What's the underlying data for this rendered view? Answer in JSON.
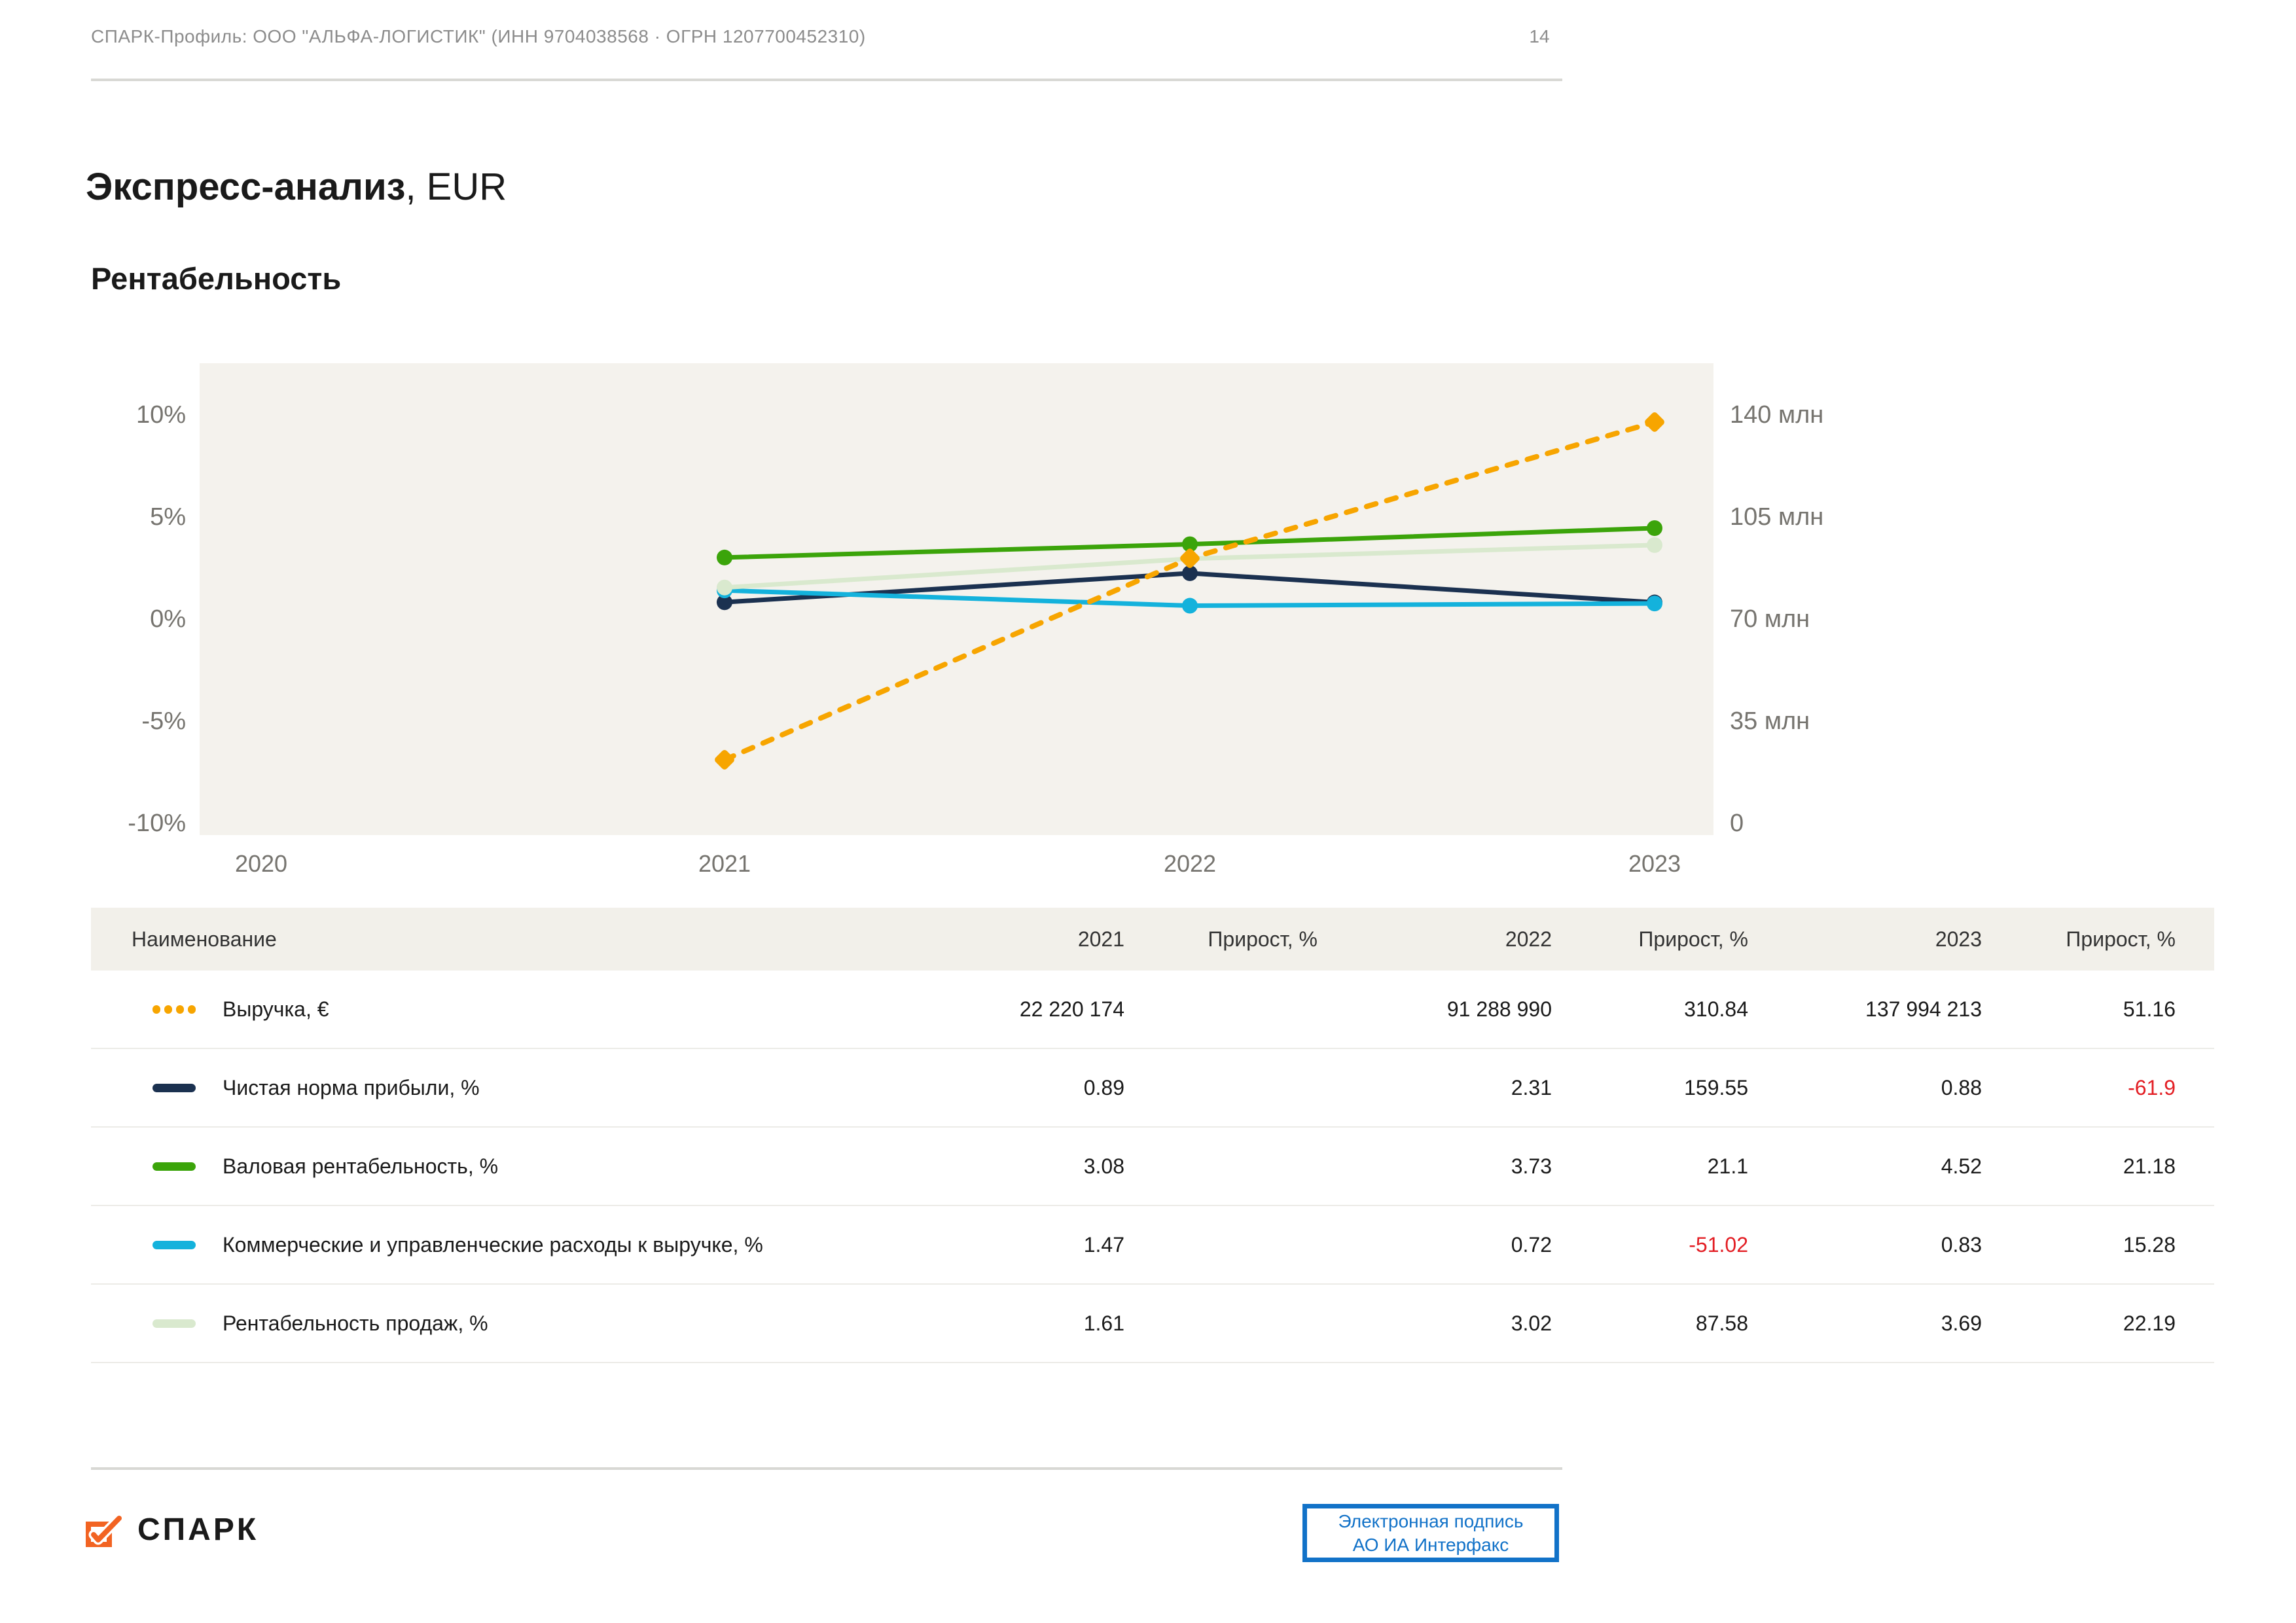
{
  "page": {
    "header": {
      "profile_line": "СПАРК-Профиль: ООО \"АЛЬФА-ЛОГИСТИК\" (ИНН 9704038568 · ОГРН 1207700452310)",
      "page_number": "14"
    },
    "title": {
      "main": "Экспресс-анализ",
      "suffix": ", EUR"
    },
    "section_title": "Рентабельность",
    "footer": {
      "logo_text": "СПАРК",
      "signature_button": {
        "line1": "Электронная подпись",
        "line2": "АО ИА Интерфакс"
      }
    }
  },
  "palette": {
    "plot_bg": "#F4F2ED",
    "table_header_bg": "#F2F0EA",
    "text": "#1A1A1A",
    "axis_text": "#76746F",
    "header_gray": "#8C8C8C",
    "divider": "#D8D8D4",
    "row_divider": "#ECEBE7",
    "negative": "#E31E24",
    "button_blue": "#1272C8",
    "logo_orange": "#F26322"
  },
  "chart_data": {
    "type": "line",
    "title": "Рентабельность",
    "categories": [
      "2020",
      "2021",
      "2022",
      "2023"
    ],
    "grid": false,
    "legend_position": "table-below",
    "left_axis": {
      "unit": "%",
      "min": -10,
      "max": 10,
      "ticks": [
        "10%",
        "5%",
        "0%",
        "-5%",
        "-10%"
      ]
    },
    "right_axis": {
      "unit": "млн",
      "min": 0,
      "max": 140,
      "ticks": [
        "140 млн",
        "105 млн",
        "70 млн",
        "35 млн",
        "0"
      ]
    },
    "series": [
      {
        "name": "Выручка, €",
        "axis": "right",
        "style": "dashed",
        "marker": "diamond",
        "color": "#F7A500",
        "values": [
          null,
          22220174,
          91288990,
          137994213
        ]
      },
      {
        "name": "Чистая норма прибыли, %",
        "axis": "left",
        "style": "solid",
        "marker": "circle",
        "color": "#1B3150",
        "values": [
          null,
          0.89,
          2.31,
          0.88
        ]
      },
      {
        "name": "Валовая рентабельность, %",
        "axis": "left",
        "style": "solid",
        "marker": "circle",
        "color": "#3BA40A",
        "values": [
          null,
          3.08,
          3.73,
          4.52
        ]
      },
      {
        "name": "Коммерческие и управленческие расходы к выручке, %",
        "axis": "left",
        "style": "solid",
        "marker": "circle",
        "color": "#14B2DC",
        "values": [
          null,
          1.47,
          0.72,
          0.83
        ]
      },
      {
        "name": "Рентабельность продаж, %",
        "axis": "left",
        "style": "solid",
        "marker": "circle",
        "color": "#D9E9CE",
        "values": [
          null,
          1.61,
          3.02,
          3.69
        ]
      }
    ]
  },
  "table": {
    "columns": [
      "Наименование",
      "2021",
      "Прирост, %",
      "2022",
      "Прирост, %",
      "2023",
      "Прирост, %"
    ],
    "rows": [
      {
        "name": "Выручка, €",
        "series_index": 0,
        "values": [
          "22 220 174",
          "",
          "91 288 990",
          "310.84",
          "137 994 213",
          "51.16"
        ]
      },
      {
        "name": "Чистая норма прибыли, %",
        "series_index": 1,
        "values": [
          "0.89",
          "",
          "2.31",
          "159.55",
          "0.88",
          "-61.9"
        ]
      },
      {
        "name": "Валовая рентабельность, %",
        "series_index": 2,
        "values": [
          "3.08",
          "",
          "3.73",
          "21.1",
          "4.52",
          "21.18"
        ]
      },
      {
        "name": "Коммерческие и управленческие расходы к выручке, %",
        "series_index": 3,
        "values": [
          "1.47",
          "",
          "0.72",
          "-51.02",
          "0.83",
          "15.28"
        ]
      },
      {
        "name": "Рентабельность продаж, %",
        "series_index": 4,
        "values": [
          "1.61",
          "",
          "3.02",
          "87.58",
          "3.69",
          "22.19"
        ]
      }
    ]
  }
}
